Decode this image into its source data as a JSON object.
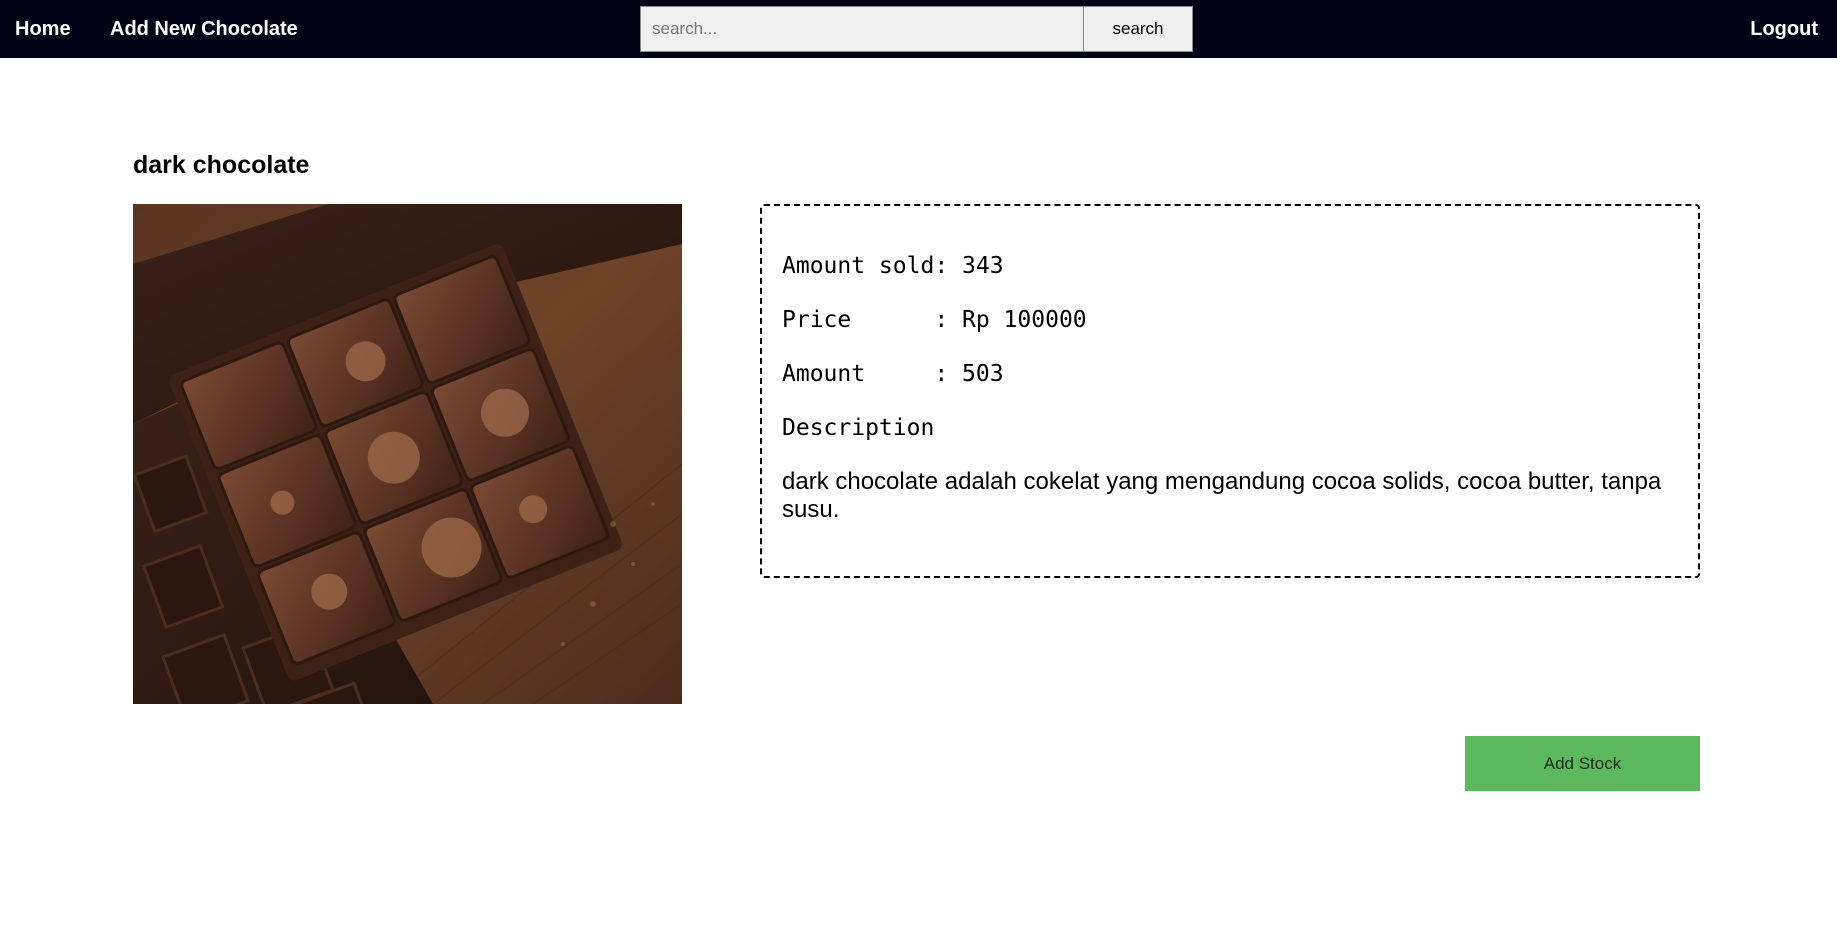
{
  "navbar": {
    "home_label": "Home",
    "add_label": "Add New Chocolate",
    "logout_label": "Logout",
    "background_color": "#020216"
  },
  "search": {
    "placeholder": "search...",
    "value": "",
    "button_label": "search"
  },
  "product": {
    "name": "dark chocolate",
    "image_icon": "chocolate-bar-photo",
    "amount_sold_line": "Amount sold: 343",
    "price_line": "Price      : Rp 100000",
    "amount_line": "Amount     : 503",
    "description_label": "Description",
    "description": "dark chocolate adalah cokelat yang mengandung cocoa solids, cocoa butter, tanpa susu."
  },
  "actions": {
    "add_stock_label": "Add Stock",
    "add_stock_color": "#5cb85c"
  }
}
